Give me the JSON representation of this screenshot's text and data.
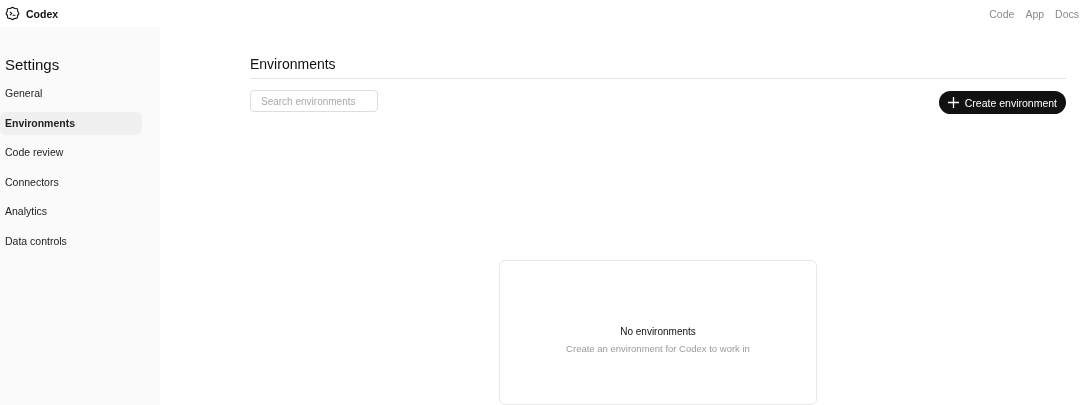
{
  "header": {
    "brand": "Codex",
    "links": [
      "Code",
      "App",
      "Docs"
    ]
  },
  "sidebar": {
    "title": "Settings",
    "items": [
      {
        "label": "General",
        "selected": false
      },
      {
        "label": "Environments",
        "selected": true
      },
      {
        "label": "Code review",
        "selected": false
      },
      {
        "label": "Connectors",
        "selected": false
      },
      {
        "label": "Analytics",
        "selected": false
      },
      {
        "label": "Data controls",
        "selected": false
      }
    ]
  },
  "main": {
    "title": "Environments",
    "search": {
      "placeholder": "Search environments"
    },
    "create_button": "Create environment",
    "empty_state": {
      "title": "No environments",
      "message": "Create an environment for Codex to work in"
    }
  }
}
